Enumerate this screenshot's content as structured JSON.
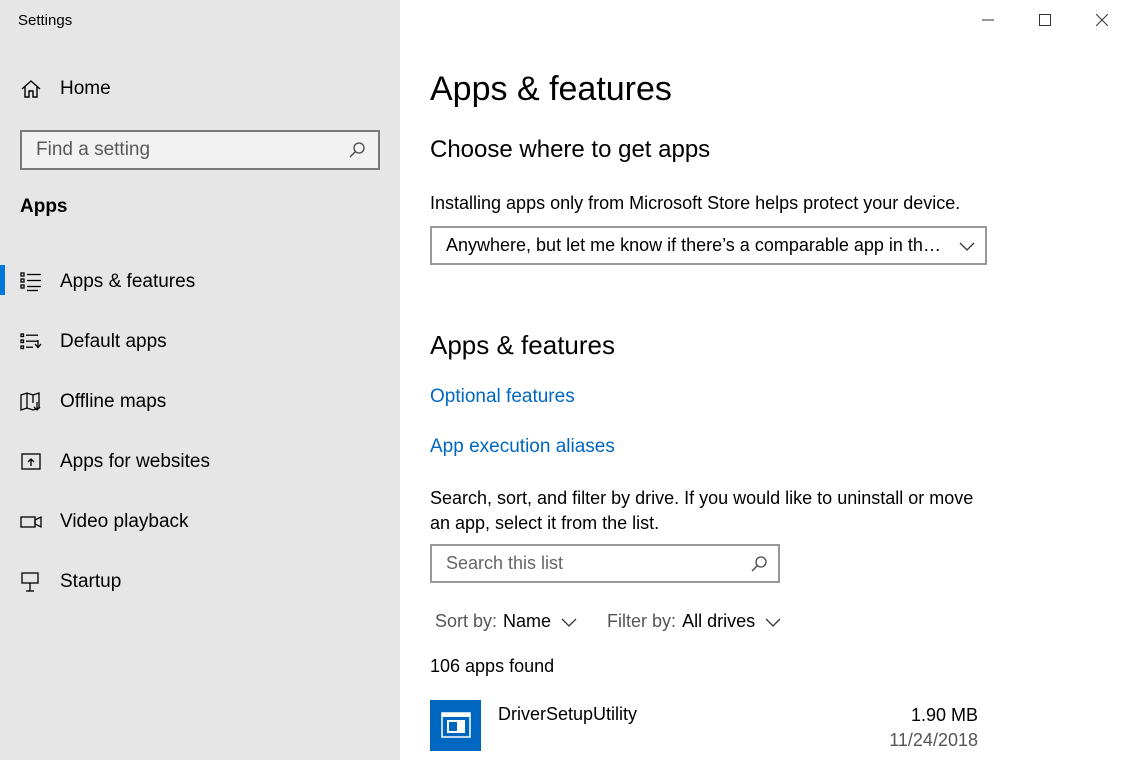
{
  "window": {
    "title": "Settings",
    "controls": {
      "minimize": "minimize-icon",
      "maximize": "maximize-icon",
      "close": "close-icon"
    }
  },
  "sidebar": {
    "home": {
      "label": "Home",
      "icon": "home-icon"
    },
    "search": {
      "placeholder": "Find a setting",
      "icon": "search-icon"
    },
    "section": "Apps",
    "items": [
      {
        "label": "Apps & features",
        "icon": "apps-features-icon",
        "selected": true
      },
      {
        "label": "Default apps",
        "icon": "default-apps-icon"
      },
      {
        "label": "Offline maps",
        "icon": "offline-maps-icon"
      },
      {
        "label": "Apps for websites",
        "icon": "apps-websites-icon"
      },
      {
        "label": "Video playback",
        "icon": "video-playback-icon"
      },
      {
        "label": "Startup",
        "icon": "startup-icon"
      }
    ],
    "accent_color": "#0078d7"
  },
  "main": {
    "title": "Apps & features",
    "choose": {
      "heading": "Choose where to get apps",
      "description": "Installing apps only from Microsoft Store helps protect your device.",
      "dropdown_value": "Anywhere, but let me know if there’s a comparable app in the Microsoft Store"
    },
    "apps_section": {
      "heading": "Apps & features",
      "links": [
        "Optional features",
        "App execution aliases"
      ],
      "description": "Search, sort, and filter by drive. If you would like to uninstall or move an app, select it from the list.",
      "search_placeholder": "Search this list",
      "sort": {
        "label": "Sort by:",
        "value": "Name"
      },
      "filter": {
        "label": "Filter by:",
        "value": "All drives"
      },
      "count": "106 apps found",
      "apps": [
        {
          "name": "DriverSetupUtility",
          "size": "1.90 MB",
          "date": "11/24/2018",
          "icon": "app-window-icon",
          "color": "#0067c0"
        }
      ]
    },
    "link_color": "#0067c0"
  }
}
